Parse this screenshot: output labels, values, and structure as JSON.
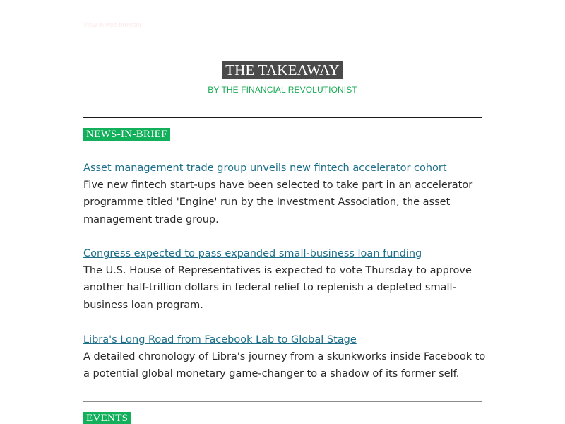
{
  "preheader": {
    "text": "View in web browser"
  },
  "masthead": {
    "title": "THE TAKEAWAY",
    "byline": "BY THE FINANCIAL REVOLUTIONIST"
  },
  "sections": {
    "news": {
      "label": "NEWS-IN-BRIEF"
    },
    "events": {
      "label": "EVENTS"
    }
  },
  "articles": [
    {
      "headline": "Asset management trade group unveils new fintech accelerator cohort",
      "summary": "Five new fintech start-ups have been selected to take part in an accelerator programme titled 'Engine' run by the Investment Association, the asset management trade group."
    },
    {
      "headline": "Congress expected to pass expanded small-business loan funding",
      "summary": "The U.S. House of Representatives is expected to vote Thursday to approve another half-trillion dollars in federal relief to replenish a depleted small-business loan program."
    },
    {
      "headline": "Libra's Long Road from Facebook Lab to Global Stage",
      "summary": "A detailed chronology of Libra's journey from a skunkworks inside Facebook to a potential global monetary game-changer to a shadow of its former self."
    }
  ],
  "colors": {
    "accent_green": "#12b05a",
    "title_bg": "#4a4a4a",
    "link": "#1e6f8a"
  }
}
